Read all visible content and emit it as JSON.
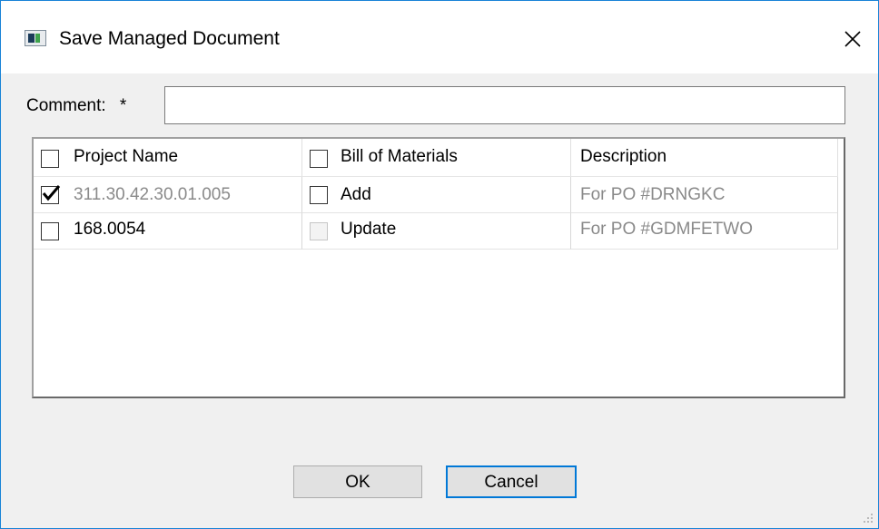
{
  "window": {
    "title": "Save Managed Document",
    "icon": "app-window-icon",
    "close_icon": "close-icon"
  },
  "comment": {
    "label": "Comment:",
    "required_marker": "*",
    "value": "",
    "placeholder": ""
  },
  "table": {
    "columns": [
      {
        "label": "Project Name",
        "has_checkbox": true,
        "checked": false
      },
      {
        "label": "Bill of Materials",
        "has_checkbox": true,
        "checked": false
      },
      {
        "label": "Description",
        "has_checkbox": false
      }
    ],
    "rows": [
      {
        "project_checked": true,
        "project_name": "311.30.42.30.01.005",
        "project_grayed": true,
        "bom_checked": false,
        "bom_enabled": true,
        "bom_label": "Add",
        "description": "For PO #DRNGKC"
      },
      {
        "project_checked": false,
        "project_name": "168.0054",
        "project_grayed": false,
        "bom_checked": false,
        "bom_enabled": false,
        "bom_label": "Update",
        "description": "For PO #GDMFETWO"
      }
    ]
  },
  "buttons": {
    "ok": "OK",
    "cancel": "Cancel"
  },
  "colors": {
    "accent": "#0078d7",
    "window_border": "#1883d7",
    "dialog_bg": "#f0f0f0",
    "grayed_text": "#8a8a8a"
  }
}
